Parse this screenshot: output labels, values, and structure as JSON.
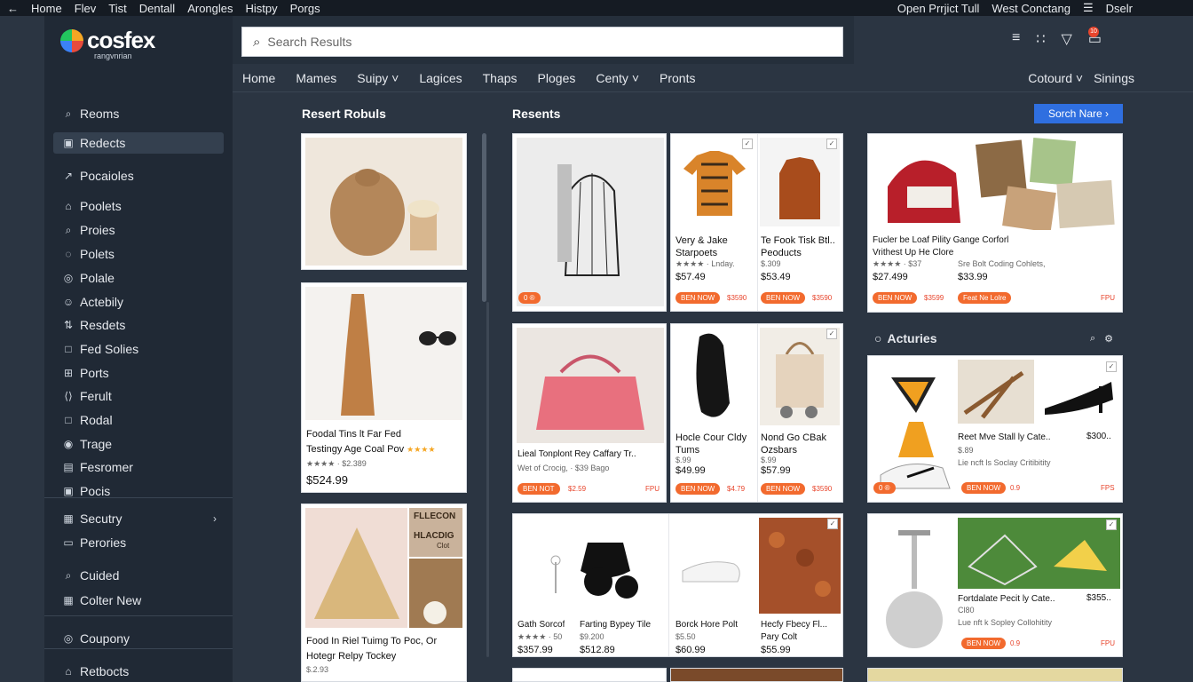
{
  "menubar": {
    "left": [
      "←",
      "Home",
      "Flev",
      "Tist",
      "Dentall",
      "Arongles",
      "Histpy",
      "Porgs"
    ],
    "right": [
      "Open Prrjict Tull",
      "West Conctang",
      "Dselr"
    ],
    "menu_icon": "☰"
  },
  "brand": {
    "name": "cosfex",
    "tagline": "rangvnrian"
  },
  "search": {
    "placeholder": "Search Results"
  },
  "toolbar_icons": [
    "list-icon",
    "grid-icon",
    "bell-icon",
    "cart-icon"
  ],
  "notification_count": "10",
  "tabs": [
    "Home",
    "Mames",
    "Suipy ˅",
    "Lagices",
    "Thaps",
    "Ploges",
    "Centy ˅",
    "Pronts"
  ],
  "tabs_right": [
    "Cotourd ˅",
    "Sinings"
  ],
  "sidebar": {
    "items": [
      {
        "label": "Reoms",
        "icon": "⌕"
      },
      {
        "label": "Redects",
        "icon": "▣"
      },
      {
        "label": "Pocaioles",
        "icon": "↗"
      },
      {
        "label": "Poolets",
        "icon": "⌂"
      },
      {
        "label": "Proies",
        "icon": "⌕"
      },
      {
        "label": "Polets",
        "icon": "◌"
      },
      {
        "label": "Polale",
        "icon": "◎"
      },
      {
        "label": "Actebily",
        "icon": "☺"
      },
      {
        "label": "Resdets",
        "icon": "⇅"
      },
      {
        "label": "Fed Solies",
        "icon": "□"
      },
      {
        "label": "Ports",
        "icon": "⊞"
      },
      {
        "label": "Ferult",
        "icon": "⟨⟩"
      },
      {
        "label": "Rodal",
        "icon": "□"
      },
      {
        "label": "Trage",
        "icon": "◉"
      },
      {
        "label": "Fesromer",
        "icon": "▤"
      },
      {
        "label": "Pocis",
        "icon": "▣"
      },
      {
        "label": "Secutry",
        "icon": "▦"
      },
      {
        "label": "Perories",
        "icon": "▭"
      },
      {
        "label": "Cuided",
        "icon": "⌕"
      },
      {
        "label": "Colter New",
        "icon": "▦"
      },
      {
        "label": "Coupony",
        "icon": "◎"
      },
      {
        "label": "Retbocts",
        "icon": "⌂"
      }
    ]
  },
  "sections": {
    "left_title": "Resert Robuls",
    "mid_title": "Resents",
    "primary_button": "Sorch Nare",
    "activities": "Acturies"
  },
  "cards": {
    "c2": {
      "title1": "Foodal Tins lt Far Fed",
      "title2": "Testingy Age Coal Pov",
      "stars": "★★★★",
      "meta": "★★★★  · $2.389",
      "price": "$524.99"
    },
    "c3": {
      "title1": "Food In Riel Tuimg To Poc, Or",
      "title2": "Hotegr Relpy Tockey",
      "meta": "$.2.93",
      "label_a": "FLLECON",
      "label_b": "HLACDIG",
      "label_c": "Clot"
    },
    "m1": {
      "pill": "0 ®"
    },
    "m2": {
      "left_title": "Very & Jake",
      "left_title2": "Starpoets",
      "left_meta": "★★★★ · Lnday.",
      "left_price": "$57.49",
      "right_title": "Te Fook Tisk Btl..",
      "right_title2": "Peoducts",
      "right_meta": "$.309",
      "right_price": "$53.49",
      "pill1": "BEN NOW",
      "old1": "$3590",
      "pill2": "BEN NOW",
      "old2": "$3590"
    },
    "m3": {
      "title": "Lieal Tonplont Rey Caffary Tr..",
      "meta": "Wet of Crocig, · $39 Bago",
      "pill": "BEN NOT",
      "old": "$2.59",
      "corner": "FPU"
    },
    "m4": {
      "left_title": "Hocle Cour Cldy",
      "left_title2": "Tums",
      "left_meta": "$.99",
      "left_price": "$49.99",
      "right_title": "Nond Go CBak",
      "right_title2": "Ozsbars",
      "right_meta": "$.99",
      "right_price": "$57.99",
      "pill1": "BEN NOW",
      "old1": "$4.79",
      "pill2": "BEN NOW",
      "old2": "$3590"
    },
    "m5": {
      "left_title": "Gath Sorcof",
      "left_meta": "★★★★ · 50",
      "left_price": "$357.99",
      "right_title": "Farting Bypey Tile",
      "right_meta": "$9.200",
      "right_price": "$512.89"
    },
    "m6": {
      "left_title": "Borck Hore Polt",
      "left_meta": "$5.50",
      "left_price": "$60.99",
      "right_title": "Hecfy Fbecy Fl...",
      "right_title2": "Pary Colt",
      "right_price": "$55.99"
    },
    "r1": {
      "title": "Fucler be Loaf Pility Gange Corforl",
      "title2": "Vrithest Up He Clore",
      "meta_left": "★★★★ · $37",
      "meta_right": "Sre Bolt Coding Cohlets,",
      "price_left": "$27.499",
      "price_right": "$33.99",
      "pill1": "BEN NOW",
      "old1": "$3599",
      "pill2": "Feat Ne Lolre",
      "corner": "FPU"
    },
    "r2": {
      "title": "Reet Mve Stall ly Cate..",
      "price_right": "$300..",
      "meta": "$.89",
      "sub": "Lie ncft ls Soclay Critibitity",
      "pill0": "0 ®",
      "pill": "BEN NOW",
      "old": "0.9",
      "corner": "FPS"
    },
    "r3": {
      "title": "Fortdalate Pecit ly Cate..",
      "price_right": "$355..",
      "meta": "Cl80",
      "sub": "Lue nft k Sopley Collohitity",
      "pill": "BEN NOW",
      "old": "0.9",
      "corner": "FPU"
    }
  },
  "colors": {
    "accent": "#2f6fe0",
    "pill": "#f26a2e",
    "sidebar": "#202935",
    "page": "#2b3542"
  }
}
